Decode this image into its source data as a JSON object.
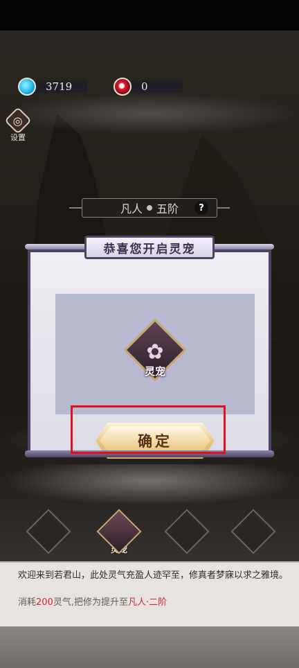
{
  "resources": {
    "spirit_stones": "3719",
    "red_orbs": "0"
  },
  "settings": {
    "label": "设置"
  },
  "rank": {
    "realm": "凡人",
    "stage": "五阶",
    "help": "?"
  },
  "dialog": {
    "title": "恭喜您开启灵宠",
    "item_label": "灵宠",
    "confirm_label": "确定"
  },
  "pets": [
    {
      "label": ""
    },
    {
      "label": "灵宠"
    },
    {
      "label": ""
    },
    {
      "label": ""
    }
  ],
  "info": {
    "description": "欢迎来到若君山，此处灵气充盈人迹罕至，修真者梦寐以求之雅境。",
    "cost_prefix": "消耗",
    "cost_amount": "200",
    "cost_middle": "灵气,把修为提升至",
    "cost_target": "凡人·二阶"
  },
  "colors": {
    "highlight": "#e4101f",
    "accent_red": "#cf2434",
    "dialog_border": "#4d4563",
    "button_gold": "#e9c789"
  }
}
